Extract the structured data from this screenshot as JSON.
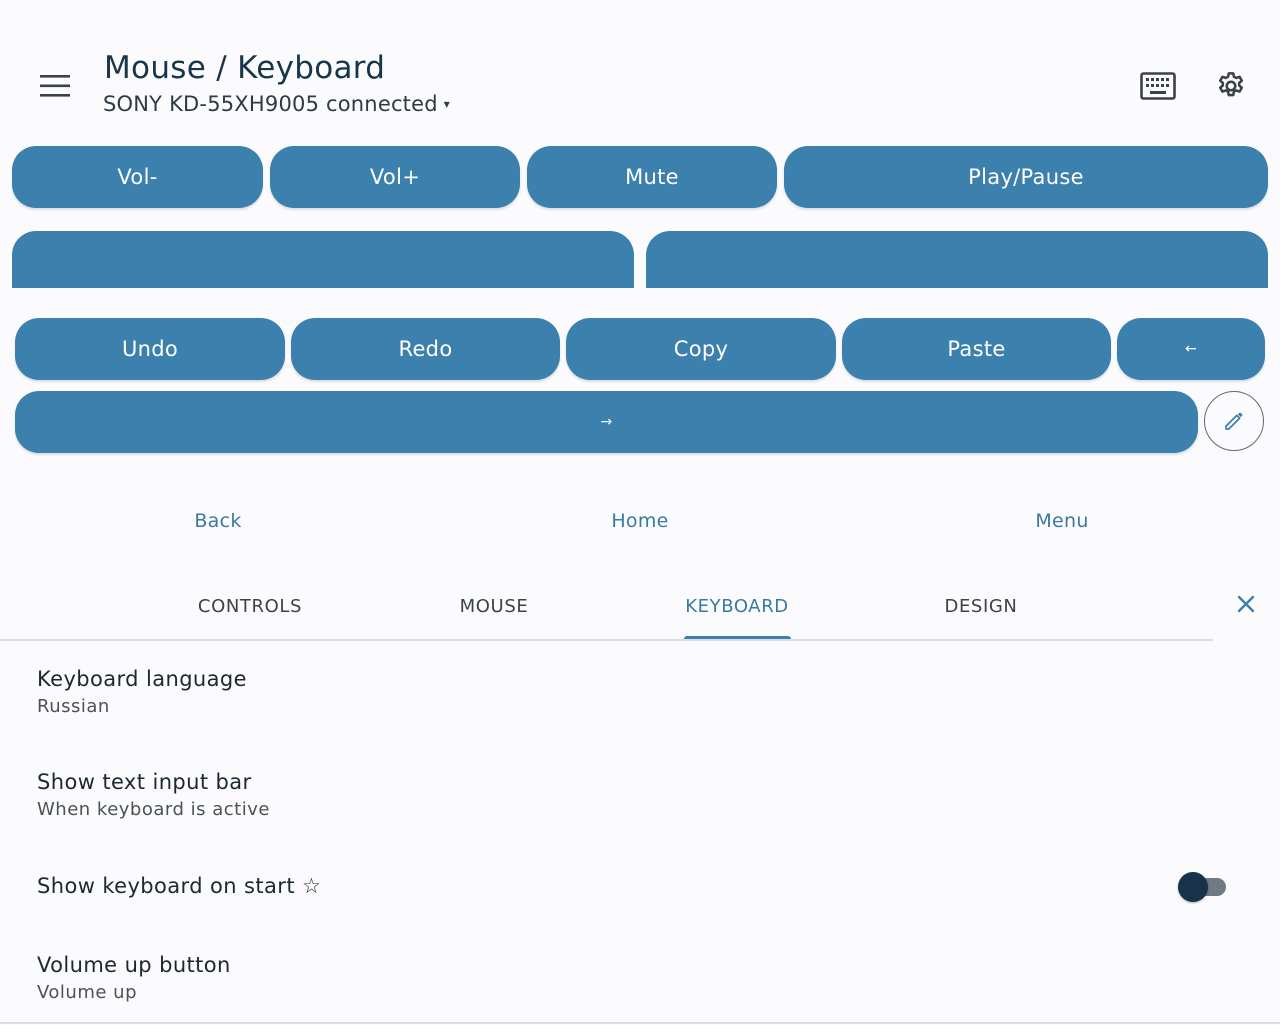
{
  "header": {
    "title": "Mouse / Keyboard",
    "device_status": "SONY KD-55XH9005 connected",
    "device_caret": "▾",
    "menu_icon": "hamburger-menu-icon",
    "keyboard_icon": "keyboard-icon",
    "settings_icon": "gear-icon"
  },
  "remote": {
    "row1": [
      "Vol-",
      "Vol+",
      "Mute",
      "Play/Pause"
    ],
    "row3": [
      "Undo",
      "Redo",
      "Copy",
      "Paste",
      "←"
    ],
    "row4_arrow": "→",
    "edit_icon": "pencil-icon"
  },
  "nav": {
    "back": "Back",
    "home": "Home",
    "menu": "Menu"
  },
  "tabs": {
    "items": [
      "CONTROLS",
      "MOUSE",
      "KEYBOARD",
      "DESIGN"
    ],
    "active": "KEYBOARD",
    "close_icon": "close-icon"
  },
  "settings": {
    "items": [
      {
        "title": "Keyboard language",
        "subtitle": "Russian"
      },
      {
        "title": "Show text input bar",
        "subtitle": "When keyboard is active"
      },
      {
        "title": "Show keyboard on start ☆",
        "toggle": false
      },
      {
        "title": "Volume up button",
        "subtitle": "Volume up"
      }
    ]
  },
  "colors": {
    "accent": "#3c80ae",
    "background": "#fbfbfe",
    "toggle_thumb": "#17324a"
  }
}
